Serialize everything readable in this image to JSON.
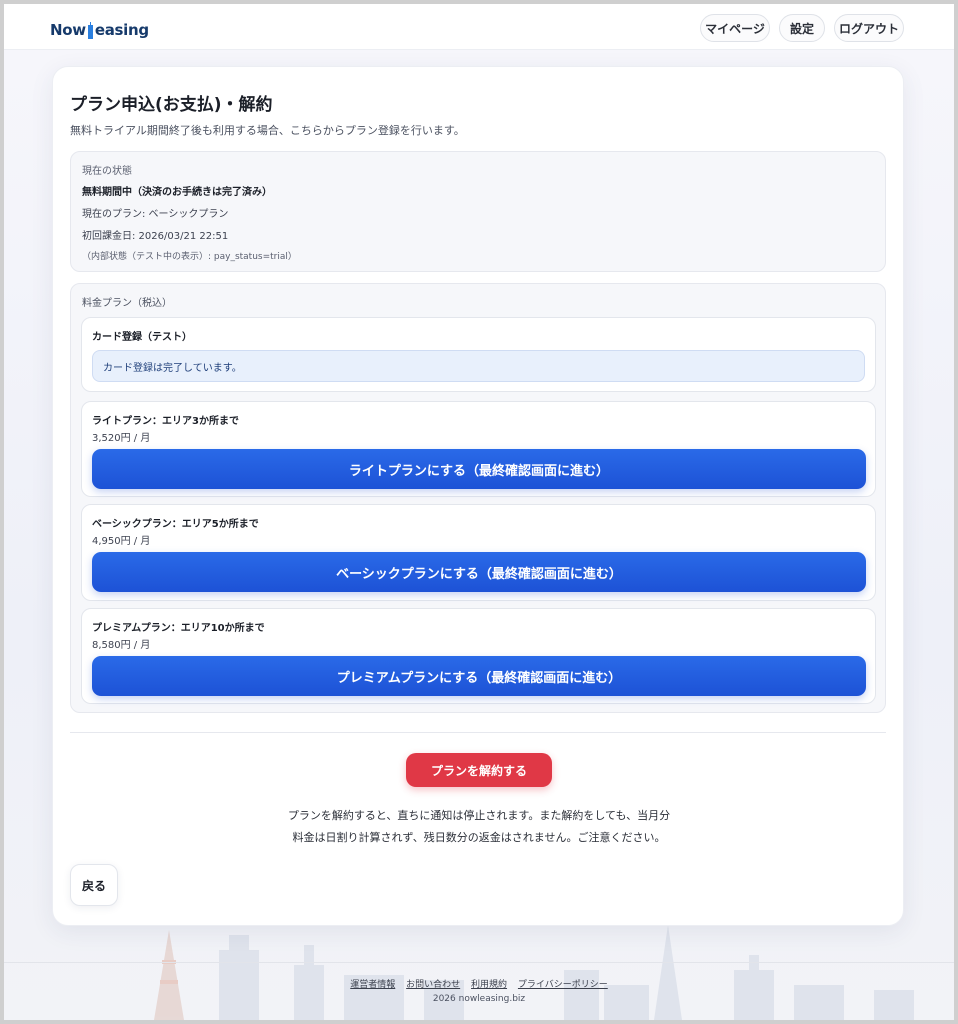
{
  "header": {
    "logo_pre": "Now",
    "logo_post": "easing",
    "nav": {
      "mypage": "マイページ",
      "settings": "設定",
      "logout": "ログアウト"
    }
  },
  "main": {
    "title": "プラン申込(お支払)・解約",
    "subtitle": "無料トライアル期間終了後も利用する場合、こちらからプラン登録を行います。",
    "status": {
      "label": "現在の状態",
      "state": "無料期間中（決済のお手続きは完了済み）",
      "current_plan": "現在のプラン: ベーシックプラン",
      "first_billing": "初回課金日: 2026/03/21 22:51",
      "internal": "（内部状態（テスト中の表示）: pay_status=trial）"
    },
    "plans": {
      "label": "料金プラン（税込）",
      "card_registration": {
        "title": "カード登録（テスト）",
        "notice": "カード登録は完了しています。"
      },
      "items": [
        {
          "title": "ライトプラン：エリア3か所まで",
          "price": "3,520円 / 月",
          "button": "ライトプランにする（最終確認画面に進む）"
        },
        {
          "title": "ベーシックプラン：エリア5か所まで",
          "price": "4,950円 / 月",
          "button": "ベーシックプランにする（最終確認画面に進む）"
        },
        {
          "title": "プレミアムプラン：エリア10か所まで",
          "price": "8,580円 / 月",
          "button": "プレミアムプランにする（最終確認画面に進む）"
        }
      ]
    },
    "cancel": {
      "button": "プランを解約する",
      "note_line1": "プランを解約すると、直ちに通知は停止されます。また解約をしても、当月分",
      "note_line2": "料金は日割り計算されず、残日数分の返金はされません。ご注意ください。"
    },
    "back_button": "戻る"
  },
  "footer": {
    "links": [
      "運営者情報",
      "お問い合わせ",
      "利用規約",
      "プライバシーポリシー"
    ],
    "copyright": "2026 nowleasing.biz"
  },
  "colors": {
    "primary": "#1d52d6",
    "danger": "#e03846",
    "logo": "#163a6b",
    "accent": "#2a7fe0"
  }
}
